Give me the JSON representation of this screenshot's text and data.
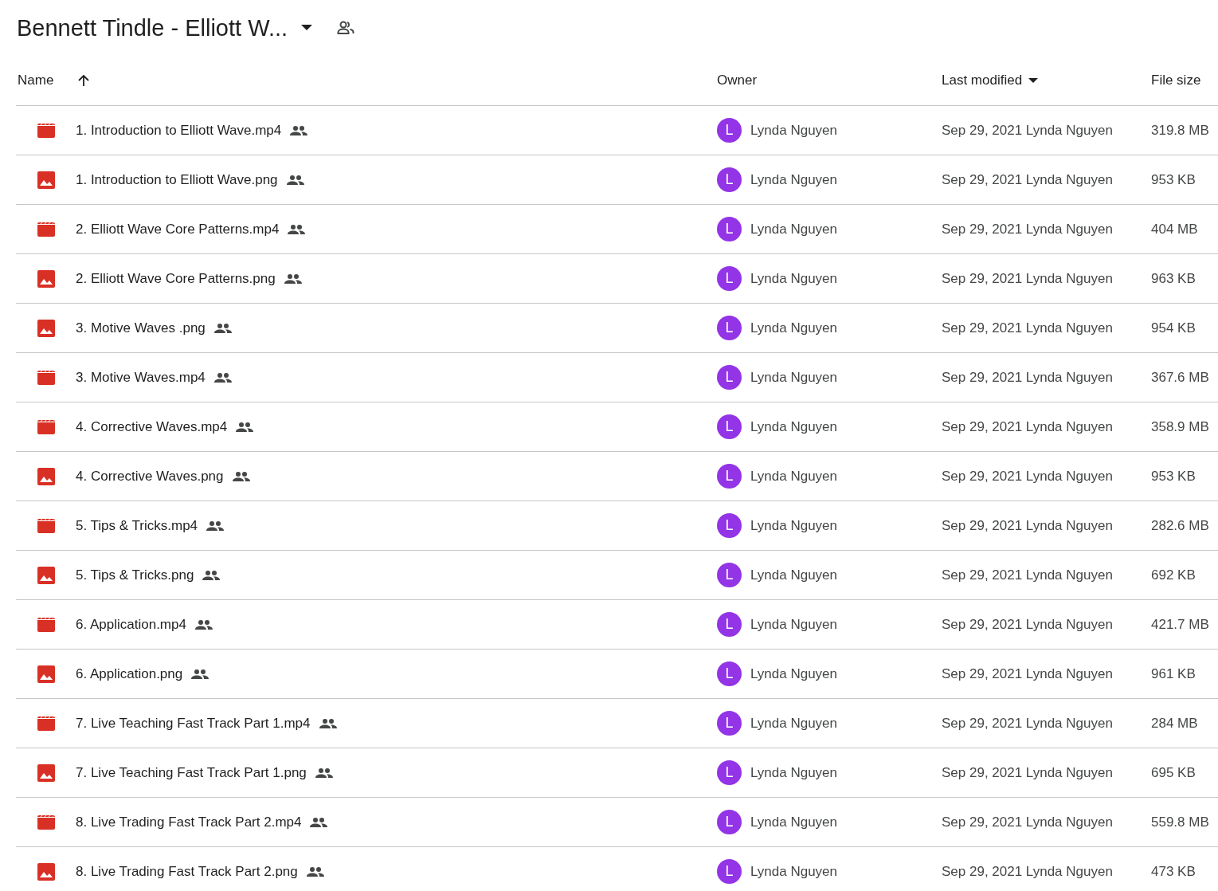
{
  "title": "Bennett Tindle - Elliott W...",
  "columns": [
    "Name",
    "Owner",
    "Last modified",
    "File size"
  ],
  "rows": [
    {
      "kind": "video",
      "name": "1. Introduction to Elliott Wave.mp4",
      "owner_initial": "L",
      "owner": "Lynda Nguyen",
      "modified": "Sep 29, 2021 Lynda Nguyen",
      "size": "319.8 MB"
    },
    {
      "kind": "image",
      "name": "1. Introduction to Elliott Wave.png",
      "owner_initial": "L",
      "owner": "Lynda Nguyen",
      "modified": "Sep 29, 2021 Lynda Nguyen",
      "size": "953 KB"
    },
    {
      "kind": "video",
      "name": "2. Elliott Wave Core Patterns.mp4",
      "owner_initial": "L",
      "owner": "Lynda Nguyen",
      "modified": "Sep 29, 2021 Lynda Nguyen",
      "size": "404 MB"
    },
    {
      "kind": "image",
      "name": "2. Elliott Wave Core Patterns.png",
      "owner_initial": "L",
      "owner": "Lynda Nguyen",
      "modified": "Sep 29, 2021 Lynda Nguyen",
      "size": "963 KB"
    },
    {
      "kind": "image",
      "name": "3. Motive Waves .png",
      "owner_initial": "L",
      "owner": "Lynda Nguyen",
      "modified": "Sep 29, 2021 Lynda Nguyen",
      "size": "954 KB"
    },
    {
      "kind": "video",
      "name": "3. Motive Waves.mp4",
      "owner_initial": "L",
      "owner": "Lynda Nguyen",
      "modified": "Sep 29, 2021 Lynda Nguyen",
      "size": "367.6 MB"
    },
    {
      "kind": "video",
      "name": "4. Corrective Waves.mp4",
      "owner_initial": "L",
      "owner": "Lynda Nguyen",
      "modified": "Sep 29, 2021 Lynda Nguyen",
      "size": "358.9 MB"
    },
    {
      "kind": "image",
      "name": "4. Corrective Waves.png",
      "owner_initial": "L",
      "owner": "Lynda Nguyen",
      "modified": "Sep 29, 2021 Lynda Nguyen",
      "size": "953 KB"
    },
    {
      "kind": "video",
      "name": "5. Tips & Tricks.mp4",
      "owner_initial": "L",
      "owner": "Lynda Nguyen",
      "modified": "Sep 29, 2021 Lynda Nguyen",
      "size": "282.6 MB"
    },
    {
      "kind": "image",
      "name": "5. Tips & Tricks.png",
      "owner_initial": "L",
      "owner": "Lynda Nguyen",
      "modified": "Sep 29, 2021 Lynda Nguyen",
      "size": "692 KB"
    },
    {
      "kind": "video",
      "name": "6. Application.mp4",
      "owner_initial": "L",
      "owner": "Lynda Nguyen",
      "modified": "Sep 29, 2021 Lynda Nguyen",
      "size": "421.7 MB"
    },
    {
      "kind": "image",
      "name": "6. Application.png",
      "owner_initial": "L",
      "owner": "Lynda Nguyen",
      "modified": "Sep 29, 2021 Lynda Nguyen",
      "size": "961 KB"
    },
    {
      "kind": "video",
      "name": "7. Live Teaching Fast Track Part 1.mp4",
      "owner_initial": "L",
      "owner": "Lynda Nguyen",
      "modified": "Sep 29, 2021 Lynda Nguyen",
      "size": "284 MB"
    },
    {
      "kind": "image",
      "name": "7. Live Teaching Fast Track Part 1.png",
      "owner_initial": "L",
      "owner": "Lynda Nguyen",
      "modified": "Sep 29, 2021 Lynda Nguyen",
      "size": "695 KB"
    },
    {
      "kind": "video",
      "name": "8. Live Trading Fast Track Part 2.mp4",
      "owner_initial": "L",
      "owner": "Lynda Nguyen",
      "modified": "Sep 29, 2021 Lynda Nguyen",
      "size": "559.8 MB"
    },
    {
      "kind": "image",
      "name": "8. Live Trading Fast Track Part 2.png",
      "owner_initial": "L",
      "owner": "Lynda Nguyen",
      "modified": "Sep 29, 2021 Lynda Nguyen",
      "size": "473 KB"
    }
  ]
}
